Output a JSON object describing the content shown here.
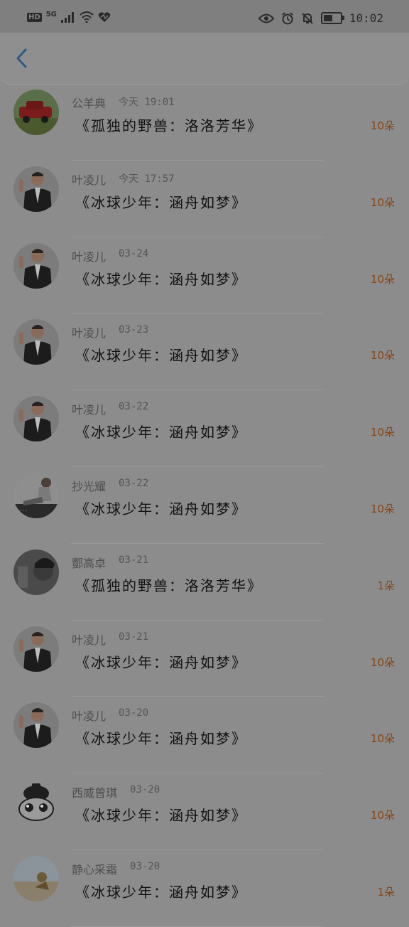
{
  "status_bar": {
    "hd": "HD",
    "network": "5G",
    "time": "10:02",
    "battery_level": 0.6
  },
  "header": {
    "back_icon": "chevron-left-icon"
  },
  "items": [
    {
      "user": "公羊典",
      "date": "今天 19:01",
      "title": "《孤独的野兽：洛洛芳华》",
      "count": "10朵",
      "avatar": "red-car"
    },
    {
      "user": "叶凌儿",
      "date": "今天 17:57",
      "title": "《冰球少年：涵舟如梦》",
      "count": "10朵",
      "avatar": "tux-boy"
    },
    {
      "user": "叶凌儿",
      "date": "03-24",
      "title": "《冰球少年：涵舟如梦》",
      "count": "10朵",
      "avatar": "tux-boy"
    },
    {
      "user": "叶凌儿",
      "date": "03-23",
      "title": "《冰球少年：涵舟如梦》",
      "count": "10朵",
      "avatar": "tux-boy"
    },
    {
      "user": "叶凌儿",
      "date": "03-22",
      "title": "《冰球少年：涵舟如梦》",
      "count": "10朵",
      "avatar": "tux-boy"
    },
    {
      "user": "抄光耀",
      "date": "03-22",
      "title": "《冰球少年：涵舟如梦》",
      "count": "10朵",
      "avatar": "sitting-person"
    },
    {
      "user": "酆高卓",
      "date": "03-21",
      "title": "《孤独的野兽：洛洛芳华》",
      "count": "1朵",
      "avatar": "dark-portrait"
    },
    {
      "user": "叶凌儿",
      "date": "03-21",
      "title": "《冰球少年：涵舟如梦》",
      "count": "10朵",
      "avatar": "tux-boy"
    },
    {
      "user": "叶凌儿",
      "date": "03-20",
      "title": "《冰球少年：涵舟如梦》",
      "count": "10朵",
      "avatar": "tux-boy"
    },
    {
      "user": "西威曾琪",
      "date": "03-20",
      "title": "《冰球少年：涵舟如梦》",
      "count": "10朵",
      "avatar": "cartoon-face"
    },
    {
      "user": "静心采霜",
      "date": "03-20",
      "title": "《冰球少年：涵舟如梦》",
      "count": "1朵",
      "avatar": "sea-dog"
    }
  ]
}
